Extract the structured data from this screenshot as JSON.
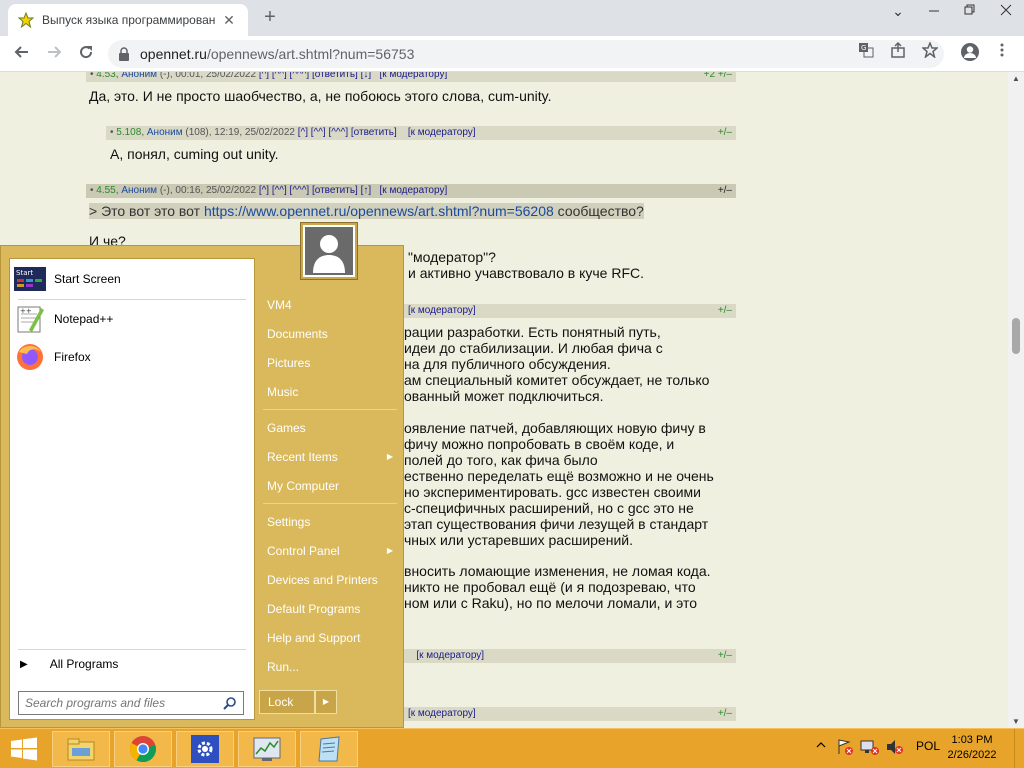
{
  "browser": {
    "tab_title": "Выпуск языка программирован",
    "url_host": "opennet.ru",
    "url_path": "/opennews/art.shtml?num=56753",
    "new_tab_label": "+",
    "minimize_glyph": "⌄",
    "close_glyph": "✕"
  },
  "comments": [
    {
      "num": "4.53",
      "author": "Аноним",
      "meta": "(-), 00:01, 25/02/2022",
      "links": "[^] [^^] [^^^] [ответить]  [↓]",
      "moderator": "[к модератору]",
      "score": "+2  +/–",
      "text": "Да, это. И не просто шаобчество, а, не побоюсь этого слова, cum-unity."
    },
    {
      "num": "5.108",
      "author": "Аноним",
      "meta": "(108), 12:19, 25/02/2022",
      "links": "[^] [^^] [^^^] [ответить]",
      "moderator": "[к модератору]",
      "score": "+/–",
      "text": "А, понял, cuming out unity."
    },
    {
      "num": "4.55",
      "author": "Аноним",
      "meta": "(-), 00:16, 25/02/2022",
      "links": "[^] [^^] [^^^] [ответить]  [↑]",
      "moderator": "[к модератору]",
      "score": "+/–",
      "quote_prefix": "> Это вот это вот ",
      "quote_link": "https://www.opennet.ru/opennews/art.shtml?num=56208",
      "quote_suffix": " сообщество?",
      "text_lines": [
        "И че?",
        "\"модератор\"?",
        "и активно учавствовало в куче RFC."
      ]
    },
    {
      "moderator": "[к модератору]",
      "score": "+/–",
      "text_lines": [
        "рации разработки. Есть понятный путь,",
        "идеи до стабилизации. И любая фича с",
        "на для публичного обсуждения.",
        "ам специальный комитет обсуждает, не только",
        "ованный может подключиться.",
        "",
        "оявление патчей, добавляющих новую фичу в",
        "фичу можно попробовать в своём коде, и",
        "полей до того, как фича было",
        "ественно переделать ещё возможно и не очень",
        "но экспериментировать. gcc известен своими",
        "с-специфичных расширений, но с gcc это не",
        "этап существования фичи лезущей в стандарт",
        "чных или устаревших расширений.",
        "",
        "вносить ломающие изменения, не ломая кода.",
        "никто не пробовал ещё (и я подозреваю, что",
        "ном или с Raku), но по мелочи ломали, и это"
      ]
    },
    {
      "moderator": "[к модератору]",
      "score": "+/–"
    },
    {
      "moderator": "[к модератору]",
      "score": "+/–"
    }
  ],
  "start_menu": {
    "pinned": [
      {
        "label": "Start Screen",
        "icon": "start-screen-icon"
      },
      {
        "label": "Notepad++",
        "icon": "notepadpp-icon"
      },
      {
        "label": "Firefox",
        "icon": "firefox-icon"
      }
    ],
    "all_programs": "All Programs",
    "search_placeholder": "Search programs and files",
    "right_items": [
      {
        "label": "VM4"
      },
      {
        "label": "Documents"
      },
      {
        "label": "Pictures"
      },
      {
        "label": "Music"
      },
      {
        "label": "Games"
      },
      {
        "label": "Recent Items",
        "submenu": true
      },
      {
        "label": "My Computer"
      },
      {
        "label": "Settings"
      },
      {
        "label": "Control Panel",
        "submenu": true
      },
      {
        "label": "Devices and Printers"
      },
      {
        "label": "Default Programs"
      },
      {
        "label": "Help and Support"
      },
      {
        "label": "Run..."
      }
    ],
    "lock_label": "Lock"
  },
  "taskbar": {
    "apps": [
      "file-explorer-icon",
      "chrome-icon",
      "settings-icon",
      "task-manager-icon",
      "notepad-icon"
    ],
    "language": "POL",
    "time": "1:03 PM",
    "date": "2/26/2022"
  },
  "colors": {
    "taskbar": "#e8a42a",
    "start_menu": "#d9b95c",
    "page_bg": "#f0f0e0"
  }
}
